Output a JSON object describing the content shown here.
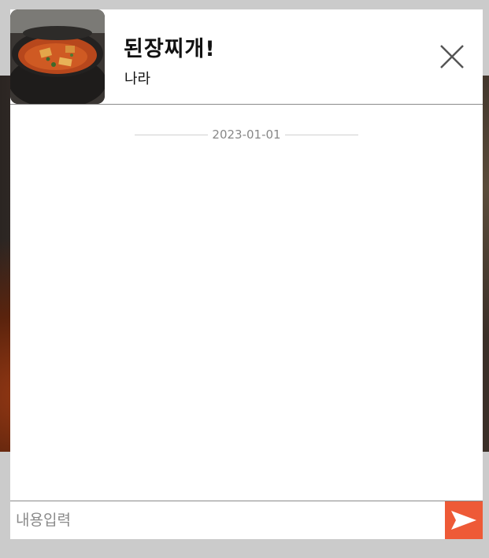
{
  "chatroom": {
    "title": "된장찌개!",
    "subtitle": "나라",
    "thumbnail_icon": "stew-photo",
    "close_icon": "close-icon"
  },
  "messages": {
    "date_separator": "2023-01-01"
  },
  "composer": {
    "value": "",
    "placeholder": "내용입력",
    "send_icon": "send-icon"
  },
  "colors": {
    "send_button": "#ee5a37",
    "divider": "#8a8a8a",
    "backdrop": "#cbcbcb"
  }
}
